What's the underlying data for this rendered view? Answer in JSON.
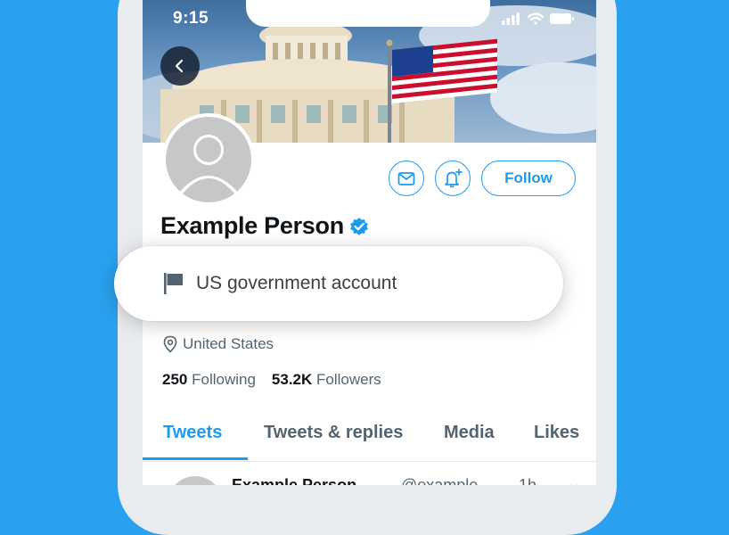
{
  "status_bar": {
    "time": "9:15"
  },
  "profile": {
    "name": "Example Person",
    "label": "US government account",
    "location": "United States",
    "following_count": "250",
    "following_label": "Following",
    "followers_count": "53.2K",
    "followers_label": "Followers"
  },
  "actions": {
    "follow_label": "Follow"
  },
  "tabs": [
    {
      "label": "Tweets",
      "active": true
    },
    {
      "label": "Tweets & replies",
      "active": false
    },
    {
      "label": "Media",
      "active": false
    },
    {
      "label": "Likes",
      "active": false
    }
  ],
  "tweet_preview": {
    "name": "Example Person",
    "handle": "@example",
    "time": "1h"
  },
  "colors": {
    "background": "#2aa1ee",
    "accent": "#1d9bf0",
    "verified": "#1d9bf0"
  },
  "icons": [
    "signal-icon",
    "wifi-icon",
    "battery-icon",
    "back-arrow-icon",
    "mail-icon",
    "bell-plus-icon",
    "verified-icon",
    "flag-icon",
    "location-pin-icon",
    "caret-down-icon"
  ]
}
